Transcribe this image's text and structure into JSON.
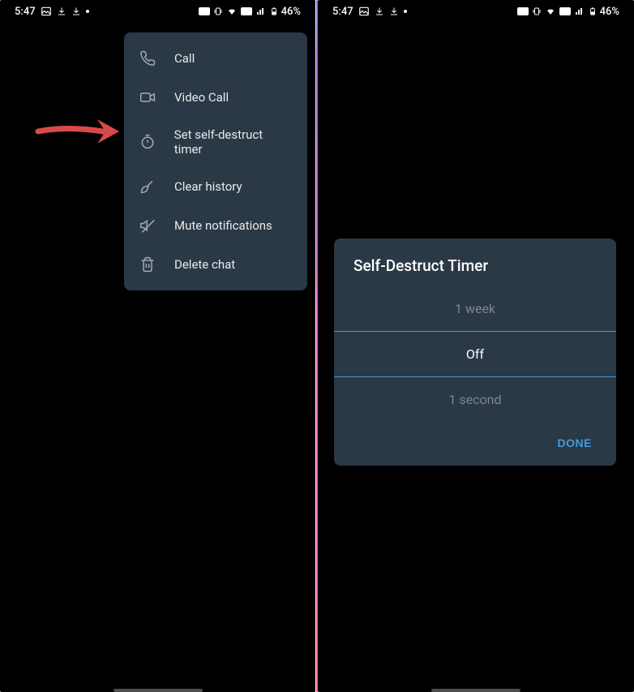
{
  "status": {
    "time": "5:47",
    "battery_text": "46%"
  },
  "menu": {
    "items": [
      {
        "label": "Call",
        "icon": "phone-icon"
      },
      {
        "label": "Video Call",
        "icon": "video-icon"
      },
      {
        "label": "Set self-destruct timer",
        "icon": "timer-icon"
      },
      {
        "label": "Clear history",
        "icon": "broom-icon"
      },
      {
        "label": "Mute notifications",
        "icon": "mute-icon"
      },
      {
        "label": "Delete chat",
        "icon": "trash-icon"
      }
    ]
  },
  "dialog": {
    "title": "Self-Destruct Timer",
    "options": {
      "before": "1 week",
      "selected": "Off",
      "after": "1 second"
    },
    "done_label": "DONE"
  }
}
